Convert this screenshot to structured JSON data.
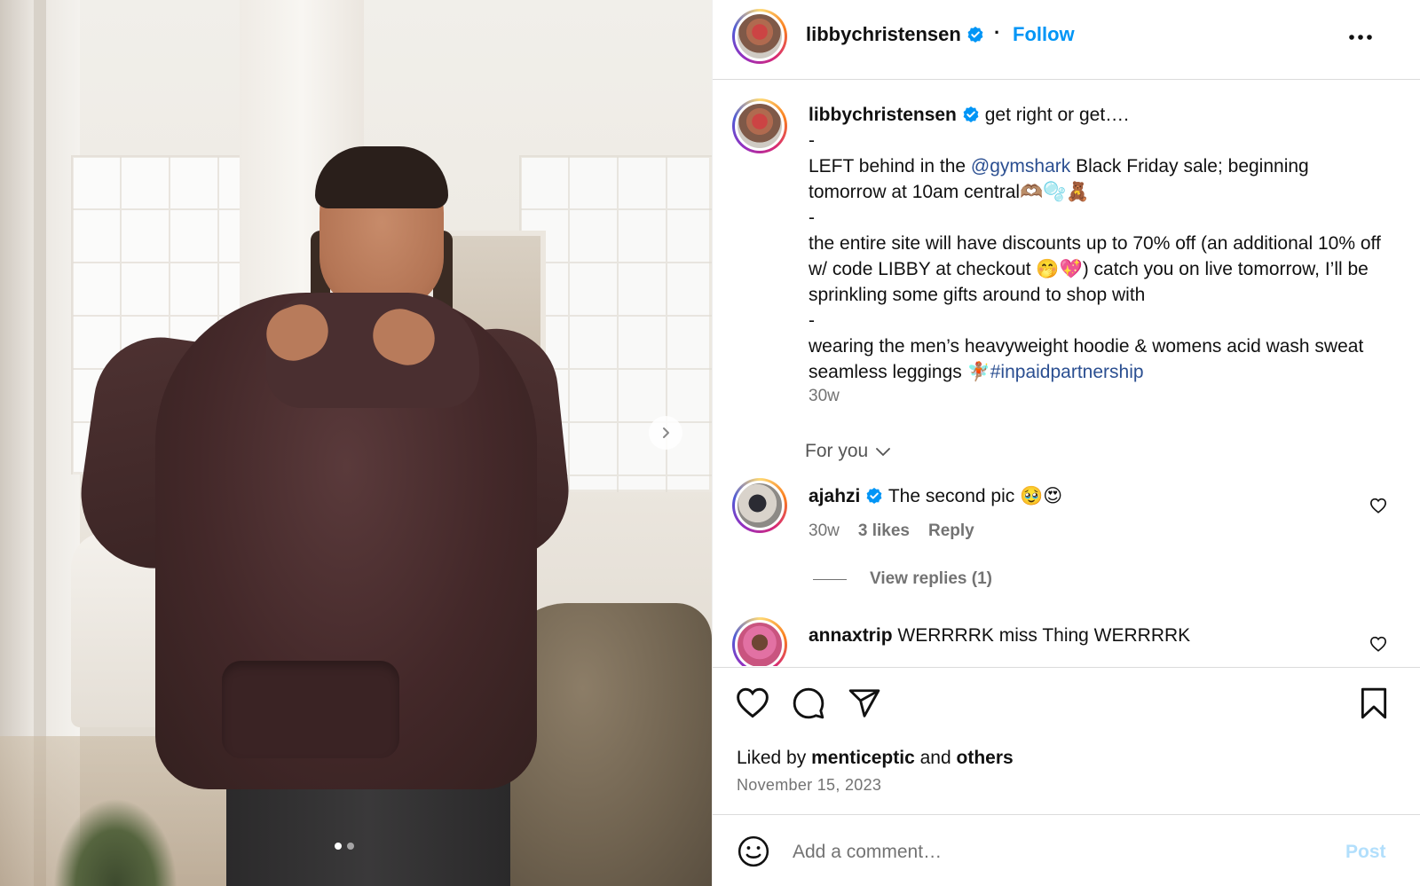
{
  "post": {
    "username": "libbychristensen",
    "follow_label": "Follow",
    "caption": {
      "username": "libbychristensen",
      "line1": "get right or get….",
      "dash1": "-",
      "p1_pre": "LEFT behind in the ",
      "p1_mention": "@gymshark",
      "p1_post": " Black Friday sale; beginning tomorrow at 10am central🫶🏽🫧🧸",
      "dash2": "-",
      "p2": "the entire site will have discounts up to 70% off (an additional 10% off w/ code LIBBY at checkout 🤭💖) catch you on live tomorrow, I’ll be sprinkling some gifts around to shop with",
      "dash3": "-",
      "p3_pre": "wearing the men’s heavyweight hoodie & womens acid wash sweat seamless leggings 🧚🏽",
      "p3_hashtag": "#inpaidpartnership",
      "time": "30w"
    },
    "for_you_label": "For you",
    "comments": [
      {
        "username": "ajahzi",
        "text": "The second pic 🥹😍",
        "time": "30w",
        "likes": "3 likes",
        "reply": "Reply",
        "view_replies": "View replies (1)"
      },
      {
        "username": "annaxtrip",
        "text": "WERRRRK miss Thing WERRRRK"
      }
    ],
    "liked_by_prefix": "Liked by",
    "liked_by_user": "menticeptic",
    "liked_by_and": "and",
    "liked_by_others": "others",
    "date": "November 15, 2023",
    "add_comment_placeholder": "Add a comment…",
    "post_label": "Post"
  },
  "carousel": {
    "slides": 2,
    "active_slide": 1
  },
  "colors": {
    "link": "#0095f6",
    "mention": "#2b4f91",
    "muted": "#737373",
    "post_disabled": "#b2dffc",
    "verified": "#0095f6"
  },
  "icons": [
    "verified-badge-icon",
    "more-options-icon",
    "chevron-down-icon",
    "heart-icon",
    "comment-icon",
    "share-icon",
    "bookmark-icon",
    "emoji-icon",
    "chevron-right-icon"
  ]
}
